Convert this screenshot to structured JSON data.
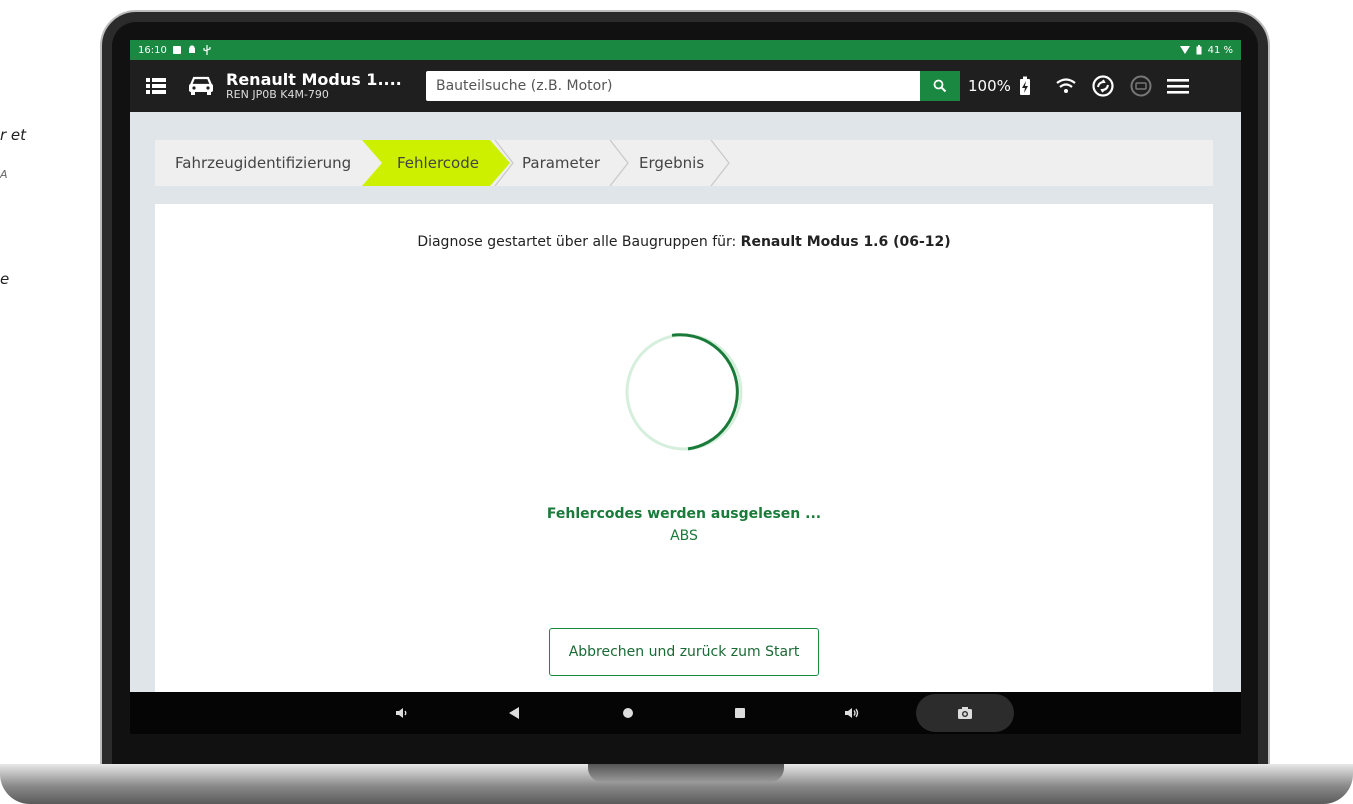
{
  "edge_text": [
    "r et",
    "A",
    "e"
  ],
  "status_bar": {
    "time": "16:10",
    "battery": "41 %"
  },
  "app_bar": {
    "vehicle_name": "Renault Modus 1....",
    "vehicle_sub": "REN JP0B K4M-790",
    "search_placeholder": "Bauteilsuche (z.B. Motor)",
    "charge_percent": "100%"
  },
  "steps": [
    {
      "label": "Fahrzeugidentifizierung",
      "active": false
    },
    {
      "label": "Fehlercode",
      "active": true
    },
    {
      "label": "Parameter",
      "active": false
    },
    {
      "label": "Ergebnis",
      "active": false
    }
  ],
  "content": {
    "headline_prefix": "Diagnose gestartet über alle Baugruppen für: ",
    "headline_vehicle": "Renault Modus 1.6 (06-12)",
    "reading_text": "Fehlercodes werden ausgelesen ...",
    "module_text": "ABS",
    "cancel_label": "Abbrechen und zurück zum Start"
  },
  "colors": {
    "brand_green": "#1a8840",
    "step_highlight": "#ccf000",
    "appbar": "#1f1f1f"
  },
  "icons": {
    "menu": "list-menu-icon",
    "vehicle": "car-icon",
    "search": "search-icon",
    "battery": "battery-charging-icon",
    "wifi": "wifi-icon",
    "sync": "sync-icon",
    "obd": "obd-adapter-icon",
    "hamburger": "hamburger-menu-icon"
  }
}
